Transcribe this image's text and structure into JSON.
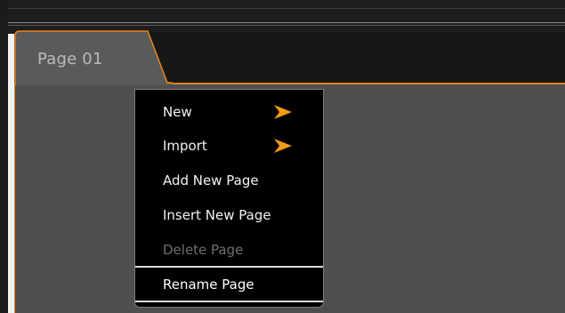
{
  "tab": {
    "label": "Page 01"
  },
  "context_menu": {
    "items": [
      {
        "label": "New",
        "has_submenu": true,
        "enabled": true
      },
      {
        "label": "Import",
        "has_submenu": true,
        "enabled": true
      },
      {
        "label": "Add New Page",
        "has_submenu": false,
        "enabled": true
      },
      {
        "label": "Insert New Page",
        "has_submenu": false,
        "enabled": true
      },
      {
        "label": "Delete Page",
        "has_submenu": false,
        "enabled": false
      },
      {
        "label": "Rename Page",
        "has_submenu": false,
        "enabled": true,
        "highlighted": true
      }
    ]
  },
  "colors": {
    "accent": "#e8841c",
    "menu_background": "#000000",
    "page_background": "#4f4f4f",
    "tab_background": "#5a5a5a",
    "disabled_text": "#6e6e6e"
  },
  "icons": {
    "submenu_arrow": "submenu-arrow-icon"
  }
}
